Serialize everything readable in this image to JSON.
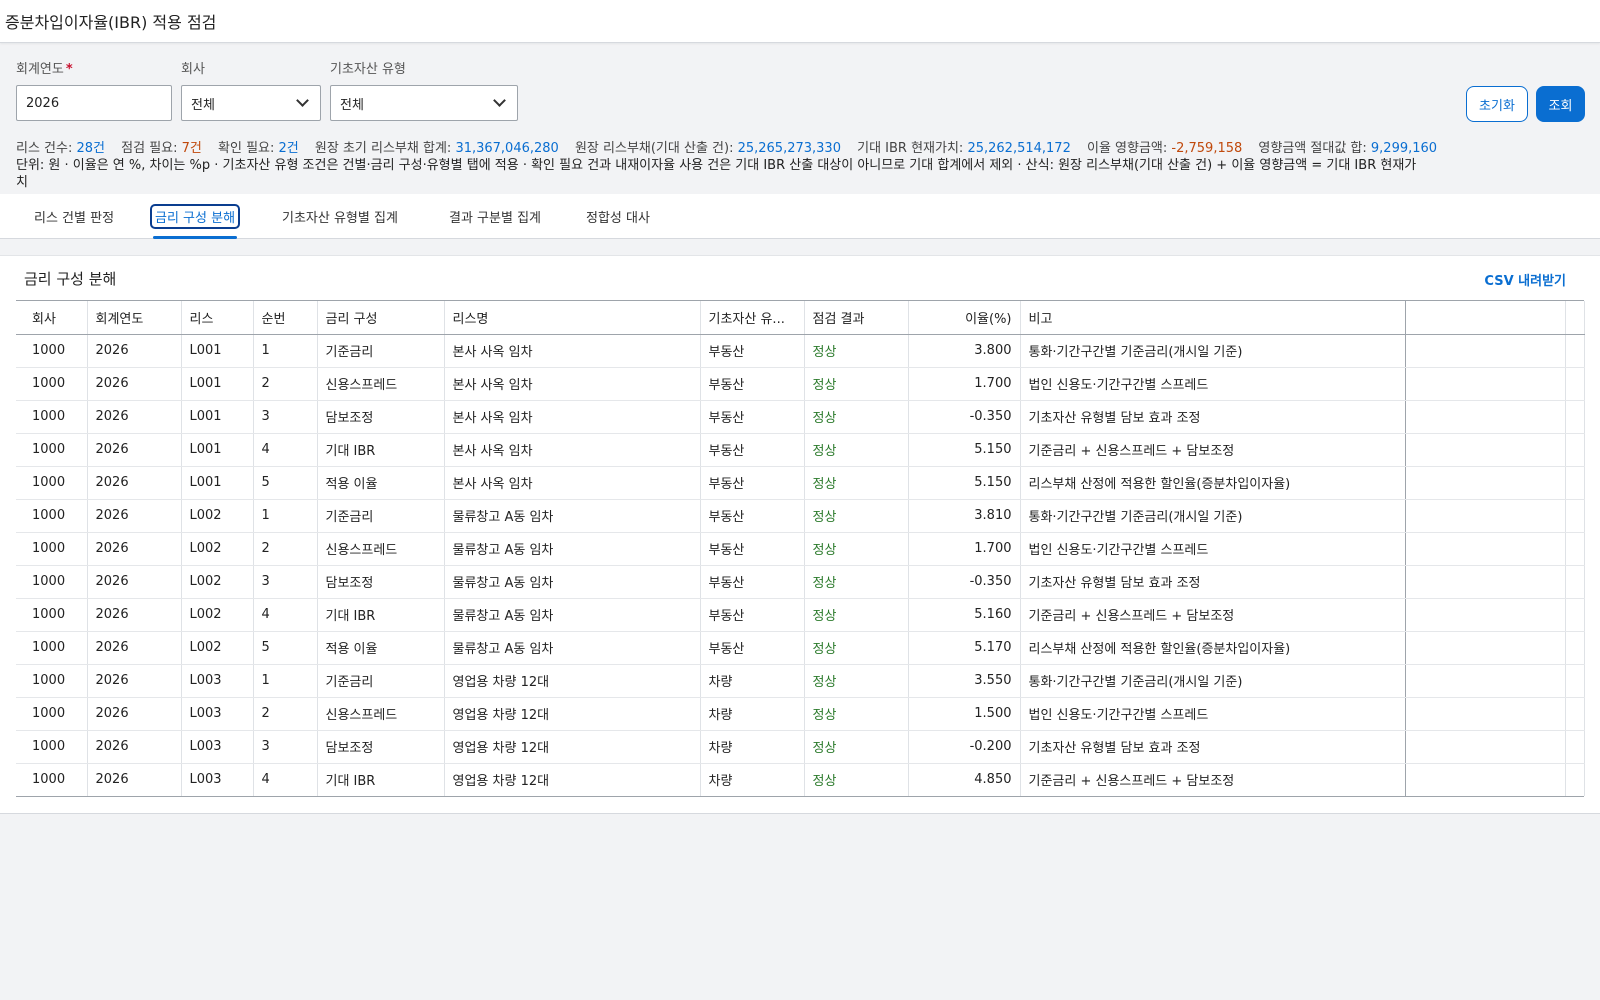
{
  "page_title": "증분차입이자율(IBR) 적용 점검",
  "filters": {
    "year_label": "회계연도",
    "year_required_mark": "*",
    "year_value": "2026",
    "company_label": "회사",
    "company_value": "전체",
    "asset_type_label": "기초자산 유형",
    "asset_type_value": "전체",
    "reset_label": "초기화",
    "search_label": "조회"
  },
  "summary": {
    "lease_count_label": "리스 건수:",
    "lease_count_value": "28건",
    "check_needed_label": "점검 필요:",
    "check_needed_value": "7건",
    "confirm_needed_label": "확인 필요:",
    "confirm_needed_value": "2건",
    "initial_liability_label": "원장 초기 리스부채 합계:",
    "initial_liability_value": "31,367,046,280",
    "ledger_liability_label": "원장 리스부채(기대 산출 건):",
    "ledger_liability_value": "25,265,273,330",
    "expected_pv_label": "기대 IBR 현재가치:",
    "expected_pv_value": "25,262,514,172",
    "interest_impact_label": "이율 영향금액:",
    "interest_impact_value": "-2,759,158",
    "abs_impact_label": "영향금액 절대값 합:",
    "abs_impact_value": "9,299,160",
    "note_line1": "단위: 원 · 이율은 연 %, 차이는 %p · 기초자산 유형 조건은 건별·금리 구성·유형별 탭에 적용 · 확인 필요 건과 내재이자율 사용 건은 기대 IBR 산출 대상이 아니므로 기대 합계에서 제외 · 산식: 원장 리스부채(기대 산출 건) + 이율 영향금액 = 기대 IBR 현재가",
    "note_line2": "치"
  },
  "tabs": [
    {
      "label": "리스 건별 판정"
    },
    {
      "label": "금리 구성 분해"
    },
    {
      "label": "기초자산 유형별 집계"
    },
    {
      "label": "결과 구분별 집계"
    },
    {
      "label": "정합성 대사"
    }
  ],
  "panel": {
    "title": "금리 구성 분해",
    "csv_label": "CSV 내려받기"
  },
  "table": {
    "columns": [
      "회사",
      "회계연도",
      "리스",
      "순번",
      "금리 구성",
      "리스명",
      "기초자산 유...",
      "점검 결과",
      "이율(%)",
      "비고"
    ],
    "rows": [
      [
        "1000",
        "2026",
        "L001",
        "1",
        "기준금리",
        "본사 사옥 임차",
        "부동산",
        "정상",
        "3.800",
        "통화·기간구간별 기준금리(개시일 기준)"
      ],
      [
        "1000",
        "2026",
        "L001",
        "2",
        "신용스프레드",
        "본사 사옥 임차",
        "부동산",
        "정상",
        "1.700",
        "법인 신용도·기간구간별 스프레드"
      ],
      [
        "1000",
        "2026",
        "L001",
        "3",
        "담보조정",
        "본사 사옥 임차",
        "부동산",
        "정상",
        "-0.350",
        "기초자산 유형별 담보 효과 조정"
      ],
      [
        "1000",
        "2026",
        "L001",
        "4",
        "기대 IBR",
        "본사 사옥 임차",
        "부동산",
        "정상",
        "5.150",
        "기준금리 + 신용스프레드 + 담보조정"
      ],
      [
        "1000",
        "2026",
        "L001",
        "5",
        "적용 이율",
        "본사 사옥 임차",
        "부동산",
        "정상",
        "5.150",
        "리스부채 산정에 적용한 할인율(증분차입이자율)"
      ],
      [
        "1000",
        "2026",
        "L002",
        "1",
        "기준금리",
        "물류창고 A동 임차",
        "부동산",
        "정상",
        "3.810",
        "통화·기간구간별 기준금리(개시일 기준)"
      ],
      [
        "1000",
        "2026",
        "L002",
        "2",
        "신용스프레드",
        "물류창고 A동 임차",
        "부동산",
        "정상",
        "1.700",
        "법인 신용도·기간구간별 스프레드"
      ],
      [
        "1000",
        "2026",
        "L002",
        "3",
        "담보조정",
        "물류창고 A동 임차",
        "부동산",
        "정상",
        "-0.350",
        "기초자산 유형별 담보 효과 조정"
      ],
      [
        "1000",
        "2026",
        "L002",
        "4",
        "기대 IBR",
        "물류창고 A동 임차",
        "부동산",
        "정상",
        "5.160",
        "기준금리 + 신용스프레드 + 담보조정"
      ],
      [
        "1000",
        "2026",
        "L002",
        "5",
        "적용 이율",
        "물류창고 A동 임차",
        "부동산",
        "정상",
        "5.170",
        "리스부채 산정에 적용한 할인율(증분차입이자율)"
      ],
      [
        "1000",
        "2026",
        "L003",
        "1",
        "기준금리",
        "영업용 차량 12대",
        "차량",
        "정상",
        "3.550",
        "통화·기간구간별 기준금리(개시일 기준)"
      ],
      [
        "1000",
        "2026",
        "L003",
        "2",
        "신용스프레드",
        "영업용 차량 12대",
        "차량",
        "정상",
        "1.500",
        "법인 신용도·기간구간별 스프레드"
      ],
      [
        "1000",
        "2026",
        "L003",
        "3",
        "담보조정",
        "영업용 차량 12대",
        "차량",
        "정상",
        "-0.200",
        "기초자산 유형별 담보 효과 조정"
      ],
      [
        "1000",
        "2026",
        "L003",
        "4",
        "기대 IBR",
        "영업용 차량 12대",
        "차량",
        "정상",
        "4.850",
        "기준금리 + 신용스프레드 + 담보조정"
      ]
    ]
  }
}
